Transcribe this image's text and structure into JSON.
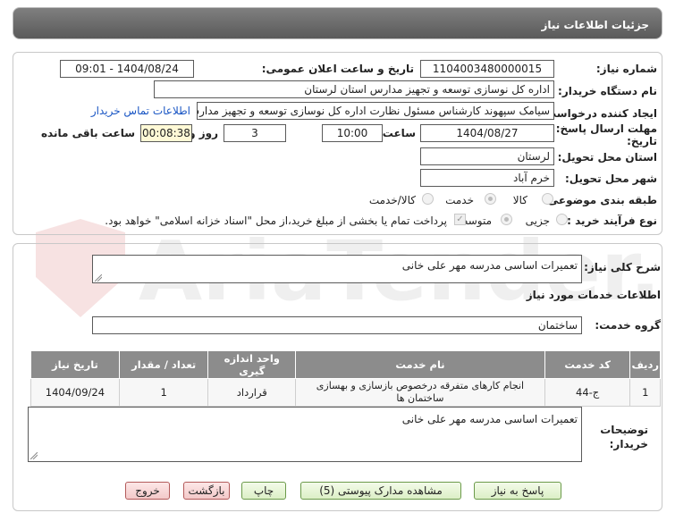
{
  "page_title": "جزئیات اطلاعات نیاز",
  "fields": {
    "need_number_label": "شماره نیاز:",
    "need_number": "1104003480000015",
    "announce_label": "تاریخ و ساعت اعلان عمومی:",
    "announce_value": "1404/08/24 - 09:01",
    "buyer_org_label": "نام دستگاه خریدار:",
    "buyer_org": "اداره کل نوسازی  توسعه و تجهیز مدارس استان لرستان",
    "creator_label": "ایجاد کننده درخواست:",
    "creator": "سیامک سپهوند کارشناس مسئول نظارت اداره کل نوسازی  توسعه و تجهیز مدارس",
    "contact_link": "اطلاعات تماس خریدار",
    "deadline_label_1": "مهلت ارسال پاسخ: تا",
    "deadline_label_2": "تاریخ:",
    "deadline_date": "1404/08/27",
    "time_label": "ساعت",
    "deadline_time": "10:00",
    "days_value": "3",
    "days_label": "روز و",
    "remaining_time": "00:08:38",
    "remaining_label": "ساعت باقی مانده",
    "province_label": "استان محل تحویل:",
    "province": "لرستان",
    "city_label": "شهر محل تحویل:",
    "city": "خرم آباد",
    "category_label": "طبقه بندی موضوعی:",
    "category_options": [
      "کالا",
      "خدمت",
      "کالا/خدمت"
    ],
    "category_selected": "خدمت",
    "process_label": "نوع فرآیند خرید :",
    "process_options": [
      "جزیی",
      "متوسط"
    ],
    "process_selected": "متوسط",
    "payment_note": "پرداخت تمام یا بخشی از مبلغ خرید،از محل \"اسناد خزانه اسلامی\" خواهد بود."
  },
  "summary": {
    "label": "شرح کلی نیاز:",
    "value": "تعمیرات اساسی مدرسه مهر علی خانی"
  },
  "services_heading": "اطلاعات خدمات مورد نیاز",
  "service_group": {
    "label": "گروه خدمت:",
    "value": "ساختمان"
  },
  "table": {
    "headers": [
      "ردیف",
      "کد خدمت",
      "نام خدمت",
      "واحد اندازه گیری",
      "تعداد / مقدار",
      "تاریخ نیاز"
    ],
    "rows": [
      [
        "1",
        "ج-44",
        "انجام کارهای متفرقه درخصوص بازسازی و بهسازی ساختمان ها",
        "قرارداد",
        "1",
        "1404/09/24"
      ]
    ]
  },
  "buyer_notes": {
    "label_1": "توضیحات",
    "label_2": "خریدار:",
    "value": "تعمیرات اساسی مدرسه مهر علی خانی"
  },
  "buttons": {
    "reply": "پاسخ به نیاز",
    "attachments": "مشاهده مدارک پیوستی (5)",
    "print": "چاپ",
    "back": "بازگشت",
    "exit": "خروج"
  },
  "watermark_text": "AriaTender.neT",
  "colors": {
    "header_bg": "#6b6b6b",
    "table_header_bg": "#8c8c8c",
    "link": "#1a56c4",
    "button_green": "#dcefc6",
    "button_red": "#f3c9c9",
    "remaining_bg": "#fff9d6"
  }
}
